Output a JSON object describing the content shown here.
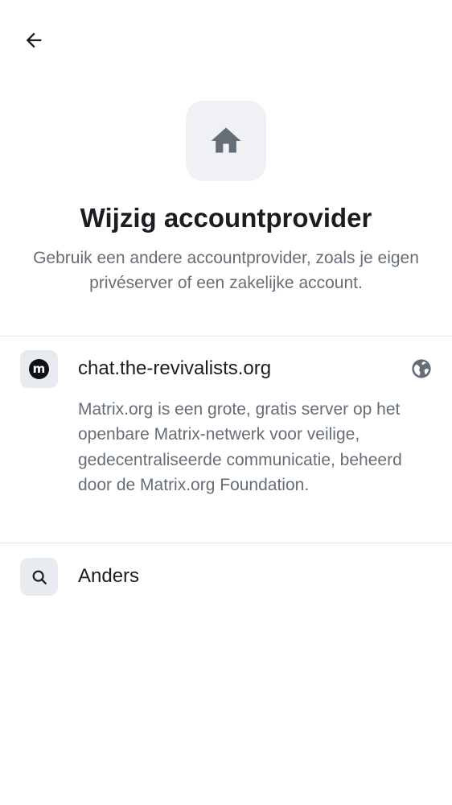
{
  "header": {
    "back_icon": "arrow-left-icon"
  },
  "hero": {
    "icon": "home-icon",
    "title": "Wijzig accountprovider",
    "subtitle": "Gebruik een andere accountprovider, zoals je eigen privéserver of een zakelijke account."
  },
  "providers": [
    {
      "logo_text": "m",
      "name": "chat.the-revivalists.org",
      "trailing_icon": "globe-icon",
      "description": "Matrix.org is een grote, gratis server op het openbare Matrix-netwerk voor veilige, gedecentraliseerde communicatie, beheerd door de Matrix.org Foundation."
    }
  ],
  "other": {
    "icon": "search-icon",
    "label": "Anders"
  },
  "colors": {
    "text_primary": "#1b1d22",
    "text_secondary": "#656d77",
    "icon_tile": "#e8ebf0",
    "hero_tile": "#f0f1f4",
    "divider": "#e1e4e8"
  }
}
